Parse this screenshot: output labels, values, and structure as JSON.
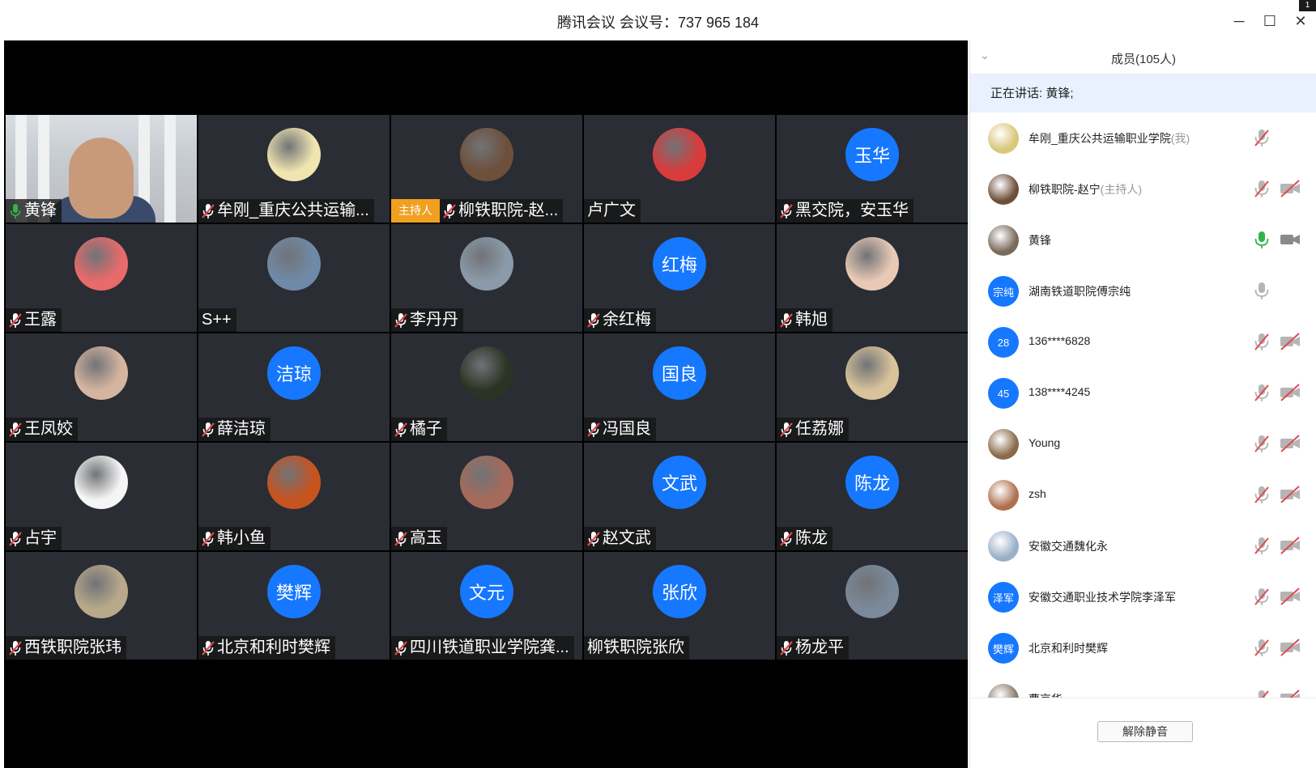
{
  "window": {
    "title": "腾讯会议 会议号：737 965 184",
    "minimize": "─",
    "maximize": "☐",
    "close": "✕",
    "corner_badge": "1"
  },
  "grid": {
    "tiles": [
      {
        "name": "黄锋",
        "kind": "camera",
        "mic": "on"
      },
      {
        "name": "牟刚_重庆公共运输...",
        "kind": "image",
        "color": "#f0e5b0",
        "mic": "off"
      },
      {
        "name": "柳铁职院-赵...",
        "kind": "image",
        "color": "#6d4f3a",
        "mic": "off",
        "host_badge": "主持人"
      },
      {
        "name": "卢广文",
        "kind": "image",
        "color": "#d93b3b",
        "mic": "none"
      },
      {
        "name": "黑交院，安玉华",
        "kind": "text",
        "avatar_text": "玉华",
        "mic": "off"
      },
      {
        "name": "王露",
        "kind": "image",
        "color": "#e86a6a",
        "mic": "off"
      },
      {
        "name": "S++",
        "kind": "image",
        "color": "#6f8aa8",
        "mic": "none"
      },
      {
        "name": "李丹丹",
        "kind": "image",
        "color": "#8a9aa8",
        "mic": "off"
      },
      {
        "name": "余红梅",
        "kind": "text",
        "avatar_text": "红梅",
        "mic": "off"
      },
      {
        "name": "韩旭",
        "kind": "image",
        "color": "#e8c9b5",
        "mic": "off"
      },
      {
        "name": "王凤姣",
        "kind": "image",
        "color": "#d6b5a0",
        "mic": "off"
      },
      {
        "name": "薛洁琼",
        "kind": "text",
        "avatar_text": "洁琼",
        "mic": "off"
      },
      {
        "name": "橘子",
        "kind": "image",
        "color": "#2b3324",
        "mic": "off"
      },
      {
        "name": "冯国良",
        "kind": "text",
        "avatar_text": "国良",
        "mic": "off"
      },
      {
        "name": "任荔娜",
        "kind": "image",
        "color": "#d9c39a",
        "mic": "off"
      },
      {
        "name": "占宇",
        "kind": "image",
        "color": "#f5f5f5",
        "mic": "off"
      },
      {
        "name": "韩小鱼",
        "kind": "image",
        "color": "#c7531e",
        "mic": "off"
      },
      {
        "name": "高玉",
        "kind": "image",
        "color": "#a66a5a",
        "mic": "off"
      },
      {
        "name": "赵文武",
        "kind": "text",
        "avatar_text": "文武",
        "mic": "off"
      },
      {
        "name": "陈龙",
        "kind": "text",
        "avatar_text": "陈龙",
        "mic": "off"
      },
      {
        "name": "西铁职院张玮",
        "kind": "image",
        "color": "#b8a98a",
        "mic": "off"
      },
      {
        "name": "北京和利时樊辉",
        "kind": "text",
        "avatar_text": "樊辉",
        "mic": "off"
      },
      {
        "name": "四川铁道职业学院龚...",
        "kind": "text",
        "avatar_text": "文元",
        "mic": "off"
      },
      {
        "name": "柳铁职院张欣",
        "kind": "text",
        "avatar_text": "张欣",
        "mic": "none"
      },
      {
        "name": "杨龙平",
        "kind": "image",
        "color": "#7a8a9a",
        "mic": "off"
      }
    ]
  },
  "sidebar": {
    "collapse_icon": "⌄",
    "title": "成员(105人)",
    "speaking": "正在讲话: 黄锋;",
    "members": [
      {
        "name": "牟刚_重庆公共运输职业学院",
        "tag": "(我)",
        "kind": "image",
        "color": "#d9c77a",
        "mic": "muted",
        "cam": "none"
      },
      {
        "name": "柳铁职院-赵宁",
        "tag": "(主持人)",
        "kind": "image",
        "color": "#6d4f3a",
        "mic": "muted",
        "cam": "off"
      },
      {
        "name": "黄锋",
        "tag": "",
        "kind": "image",
        "color": "#7a6a5a",
        "mic": "on",
        "cam": "on"
      },
      {
        "name": "湖南铁道职院傅宗纯",
        "tag": "",
        "kind": "text",
        "avatar_text": "宗纯",
        "mic": "idle",
        "cam": "none"
      },
      {
        "name": "136****6828",
        "tag": "",
        "kind": "text",
        "avatar_text": "28",
        "mic": "muted",
        "cam": "off"
      },
      {
        "name": "138****4245",
        "tag": "",
        "kind": "text",
        "avatar_text": "45",
        "mic": "muted",
        "cam": "off"
      },
      {
        "name": "Young",
        "tag": "",
        "kind": "image",
        "color": "#8a6a4a",
        "mic": "muted",
        "cam": "off"
      },
      {
        "name": "zsh",
        "tag": "",
        "kind": "image",
        "color": "#b07050",
        "mic": "muted",
        "cam": "off"
      },
      {
        "name": "安徽交通魏化永",
        "tag": "",
        "kind": "image",
        "color": "#9ab0c8",
        "mic": "muted",
        "cam": "off"
      },
      {
        "name": "安徽交通职业技术学院李泽军",
        "tag": "",
        "kind": "text",
        "avatar_text": "泽军",
        "mic": "muted",
        "cam": "off"
      },
      {
        "name": "北京和利时樊辉",
        "tag": "",
        "kind": "text",
        "avatar_text": "樊辉",
        "mic": "muted",
        "cam": "off"
      },
      {
        "name": "曹京华",
        "tag": "",
        "kind": "image",
        "color": "#8a7a6a",
        "mic": "muted",
        "cam": "off"
      }
    ],
    "unmute_button": "解除静音"
  },
  "colors": {
    "accent": "#1677ff",
    "muted_red": "#e0484f",
    "mic_green": "#34b24a",
    "host_badge": "#f0a020"
  }
}
